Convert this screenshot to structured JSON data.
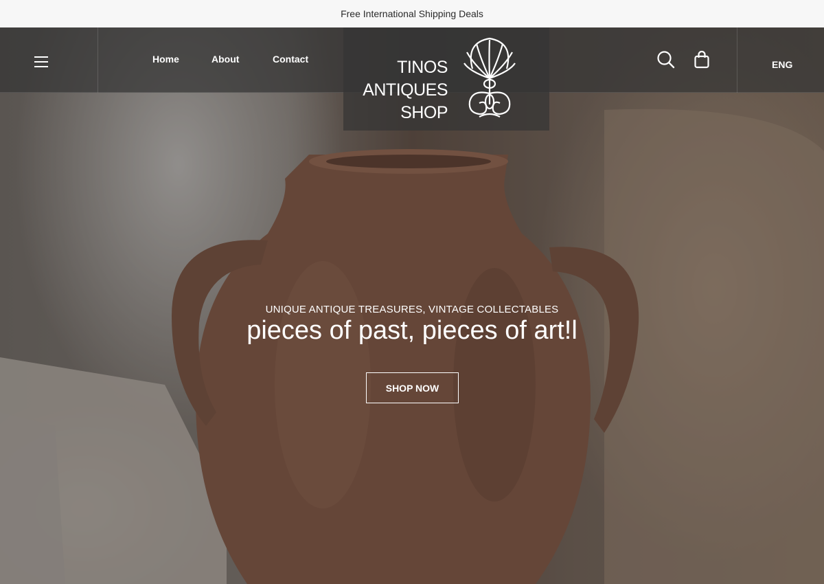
{
  "announcement": {
    "text": "Free International Shipping Deals"
  },
  "nav": {
    "links": [
      "Home",
      "About",
      "Contact"
    ],
    "language": "ENG"
  },
  "logo": {
    "lines": [
      "TINOS",
      "ANTIQUES",
      "SHOP"
    ]
  },
  "hero": {
    "kicker": "UNIQUE ANTIQUE TREASURES, VINTAGE COLLECTABLES",
    "headline": "pieces of past, pieces of art!l",
    "cta": "SHOP NOW"
  },
  "icons": {
    "menu": "hamburger-menu-icon",
    "search": "search-icon",
    "cart": "shopping-bag-icon",
    "emblem": "palmette-emblem-icon"
  },
  "colors": {
    "announcement_bg": "#f7f7f7",
    "navbar_bg": "#343434",
    "text_light": "#ffffff"
  }
}
